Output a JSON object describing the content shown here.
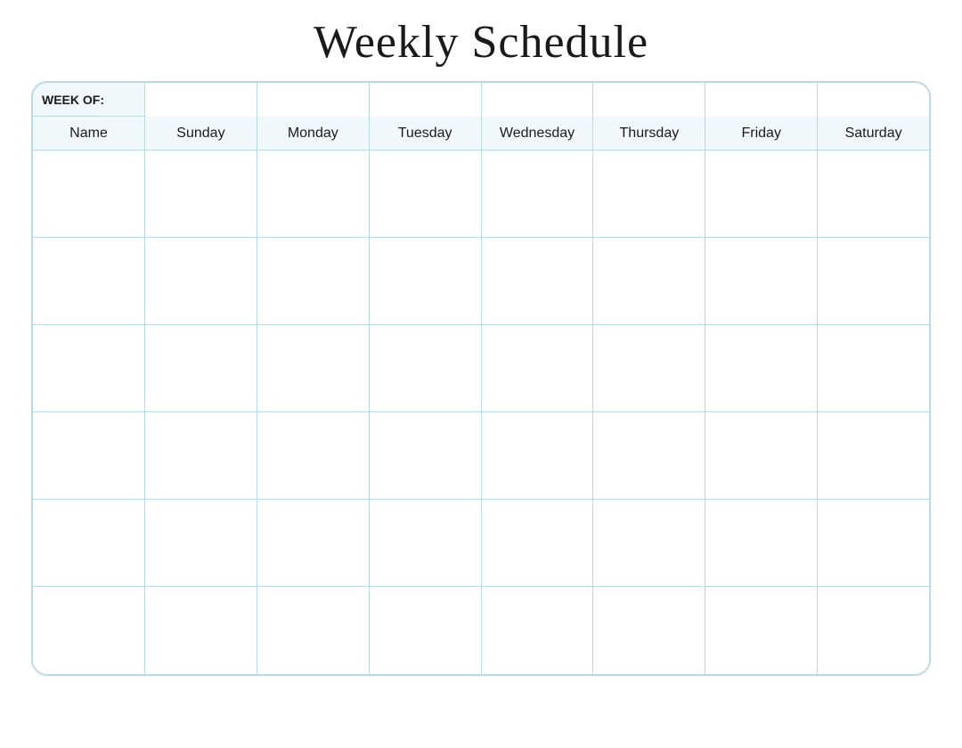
{
  "title": "Weekly Schedule",
  "week_of_label": "WEEK OF:",
  "columns": [
    {
      "label": "Name",
      "key": "name"
    },
    {
      "label": "Sunday",
      "key": "sunday"
    },
    {
      "label": "Monday",
      "key": "monday"
    },
    {
      "label": "Tuesday",
      "key": "tuesday"
    },
    {
      "label": "Wednesday",
      "key": "wednesday"
    },
    {
      "label": "Thursday",
      "key": "thursday"
    },
    {
      "label": "Friday",
      "key": "friday"
    },
    {
      "label": "Saturday",
      "key": "saturday"
    }
  ],
  "rows": [
    {
      "id": 1
    },
    {
      "id": 2
    },
    {
      "id": 3
    },
    {
      "id": 4
    },
    {
      "id": 5
    },
    {
      "id": 6
    }
  ],
  "colors": {
    "border": "#b8d9e8",
    "background": "#f0f8fc",
    "cell_bg": "#ffffff",
    "title": "#1a1a1a"
  }
}
